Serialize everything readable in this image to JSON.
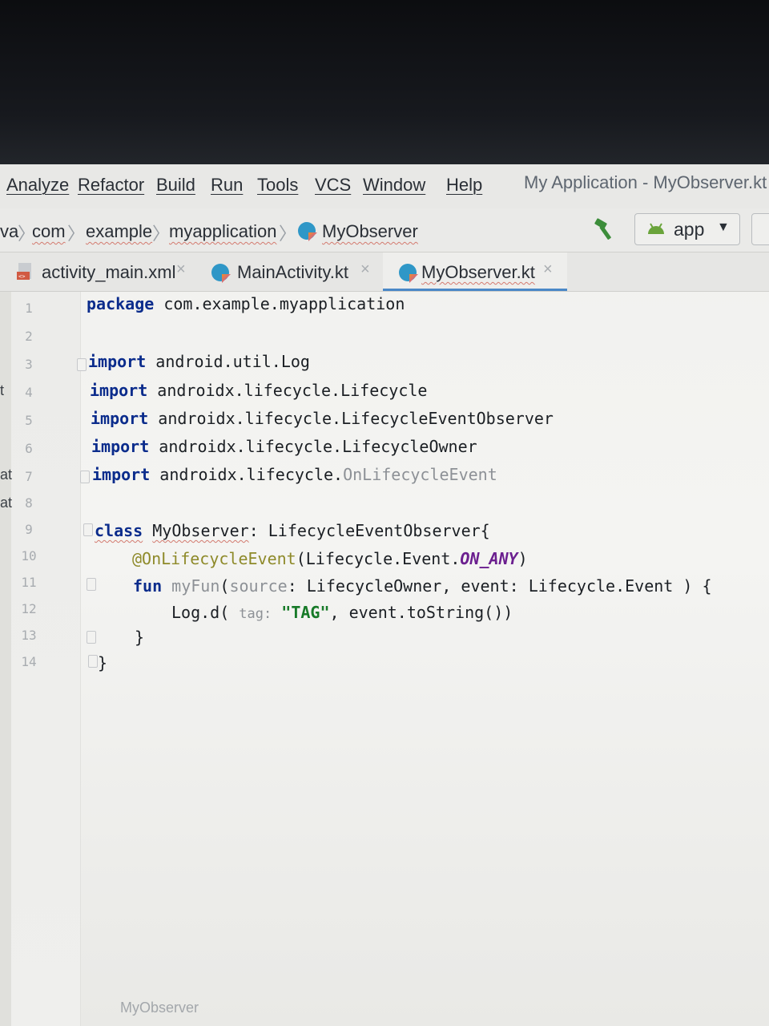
{
  "menubar": {
    "items": [
      "Analyze",
      "Refactor",
      "Build",
      "Run",
      "Tools",
      "VCS",
      "Window",
      "Help"
    ],
    "window_title": "My Application - MyObserver.kt"
  },
  "navbar": {
    "breadcrumbs": [
      "va",
      "com",
      "example",
      "myapplication",
      "MyObserver"
    ],
    "run_config": "app",
    "run_config_arrow": "▼"
  },
  "tabs": [
    {
      "label": "activity_main.xml",
      "close": "×",
      "icon": "xml-file-icon"
    },
    {
      "label": "MainActivity.kt",
      "close": "×",
      "icon": "kotlin-file-icon"
    },
    {
      "label": "MyObserver.kt",
      "close": "×",
      "icon": "kotlin-file-icon",
      "active": true
    }
  ],
  "gutter": {
    "line_numbers": [
      "1",
      "2",
      "3",
      "4",
      "5",
      "6",
      "7",
      "8",
      "9",
      "10",
      "11",
      "12",
      "13",
      "14"
    ],
    "left_cut_labels": [
      "t",
      "at",
      "at"
    ]
  },
  "code": {
    "l1": {
      "kw": "package",
      "rest": " com.example.myapplication"
    },
    "l3": {
      "kw": "import",
      "rest": " android.util.Log"
    },
    "l4": {
      "kw": "import",
      "rest": " androidx.lifecycle.Lifecycle"
    },
    "l5": {
      "kw": "import",
      "rest": " androidx.lifecycle.LifecycleEventObserver"
    },
    "l6": {
      "kw": "import",
      "rest": " androidx.lifecycle.LifecycleOwner"
    },
    "l7": {
      "kw": "import",
      "rest": " androidx.lifecycle.",
      "unused": "OnLifecycleEvent"
    },
    "l9": {
      "kw": "class",
      "name": "MyObserver",
      "rest": ": LifecycleEventObserver{"
    },
    "l10": {
      "ann": "@OnLifecycleEvent",
      "rest": "(Lifecycle.Event.",
      "const": "ON_ANY",
      "tail": ")"
    },
    "l11": {
      "kw": "fun",
      "fn": "myFun",
      "open": "(",
      "param": "source",
      "rest": ": LifecycleOwner, event: Lifecycle.Event ) {"
    },
    "l12": {
      "pre": "Log.d( ",
      "hint": "tag:",
      "str": "\"TAG\"",
      "rest": ", event.toString())"
    },
    "l13": {
      "text": "}"
    },
    "l14": {
      "text": "}"
    }
  },
  "status": {
    "breadcrumb": "MyObserver"
  }
}
